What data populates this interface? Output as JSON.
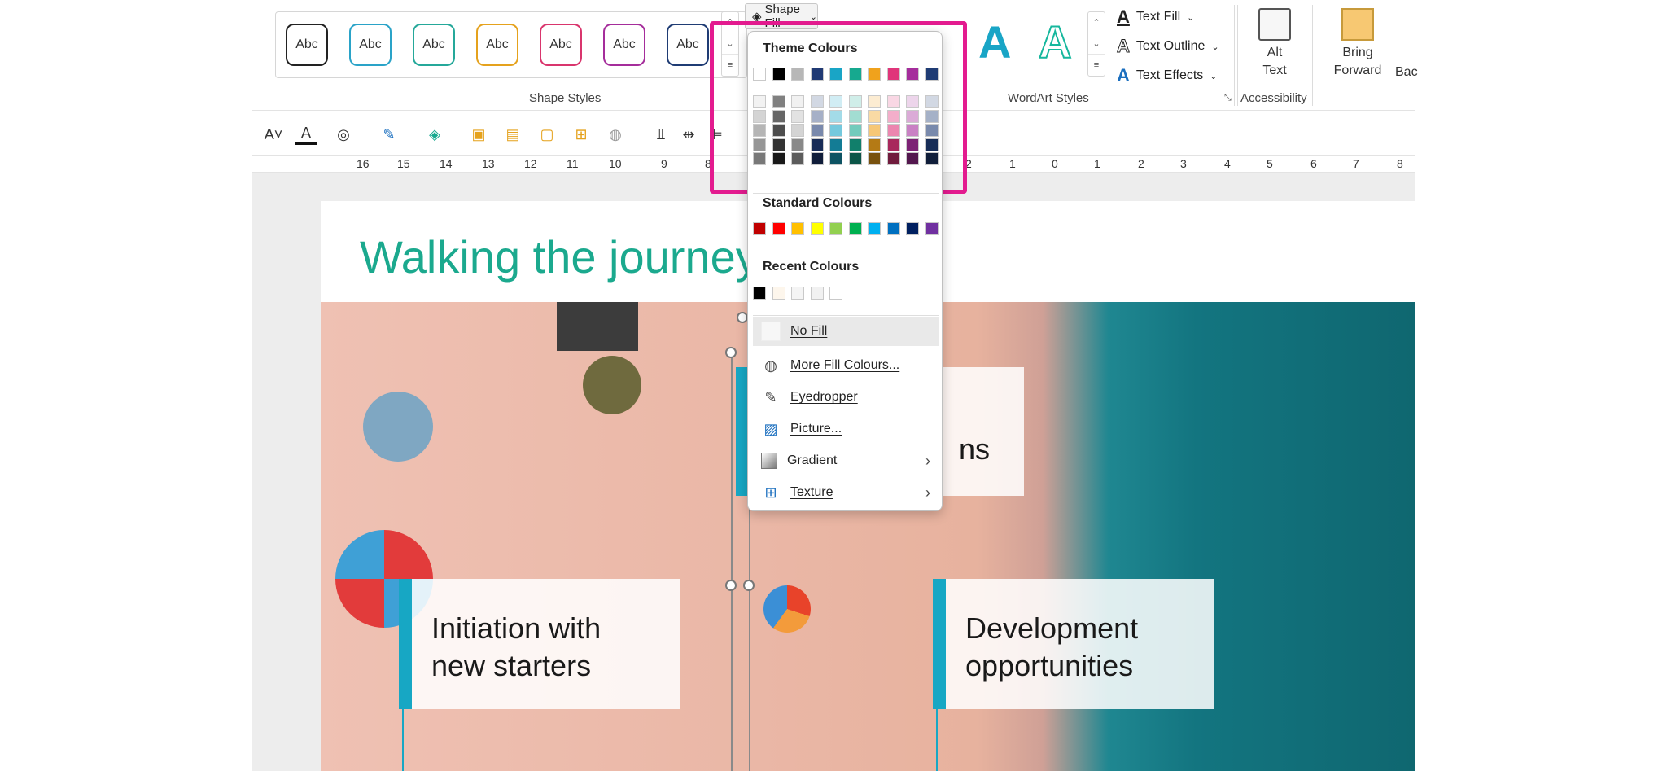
{
  "ribbon": {
    "shape_styles_label": "Shape Styles",
    "shape_style_items": [
      "Abc",
      "Abc",
      "Abc",
      "Abc",
      "Abc",
      "Abc",
      "Abc"
    ],
    "shape_style_colors": [
      "#222222",
      "#2aa3c8",
      "#25a89a",
      "#e5a21d",
      "#d9356d",
      "#a52d9b",
      "#1f3c74"
    ],
    "shape_fill_label": "Shape Fill",
    "wordart_label": "WordArt Styles",
    "wordart_letters": [
      "A",
      "A"
    ],
    "text_fill_label": "Text Fill",
    "text_outline_label": "Text Outline",
    "text_effects_label": "Text Effects",
    "accessibility_label": "Accessibility",
    "alt_text_label_1": "Alt",
    "alt_text_label_2": "Text",
    "bring_forward_label_1": "Bring",
    "bring_forward_label_2": "Forward",
    "send_backward_partial": "Bac"
  },
  "ruler": {
    "numbers": [
      "16",
      "15",
      "14",
      "13",
      "12",
      "11",
      "10",
      "9",
      "8",
      "2",
      "1",
      "0",
      "1",
      "2",
      "3",
      "4",
      "5",
      "6",
      "7",
      "8"
    ]
  },
  "slide": {
    "title": "Walking the journey",
    "card_left": "Initiation with\nnew starters",
    "card_right": "Development\nopportunities",
    "card_mid_partial": "ns"
  },
  "dropdown": {
    "theme_heading": "Theme Colours",
    "standard_heading": "Standard Colours",
    "recent_heading": "Recent Colours",
    "no_fill": "No Fill",
    "more_fill": "More Fill Colours...",
    "eyedropper": "Eyedropper",
    "picture": "Picture...",
    "gradient": "Gradient",
    "texture": "Texture",
    "theme_colors": [
      "#ffffff",
      "#000000",
      "#b7b7b7",
      "#203a74",
      "#19a5c6",
      "#16a98f",
      "#f0a21c",
      "#e0357a",
      "#a52d9c",
      "#1f3c74"
    ],
    "standard_colors": [
      "#c00000",
      "#ff0000",
      "#ffc000",
      "#ffff00",
      "#92d050",
      "#00b050",
      "#00b0f0",
      "#0070c0",
      "#002060",
      "#7030a0"
    ],
    "recent_colors": [
      "#000000",
      "#fdf6ec",
      "#f4f4f4",
      "#f1f1f1",
      "#ffffff"
    ]
  }
}
